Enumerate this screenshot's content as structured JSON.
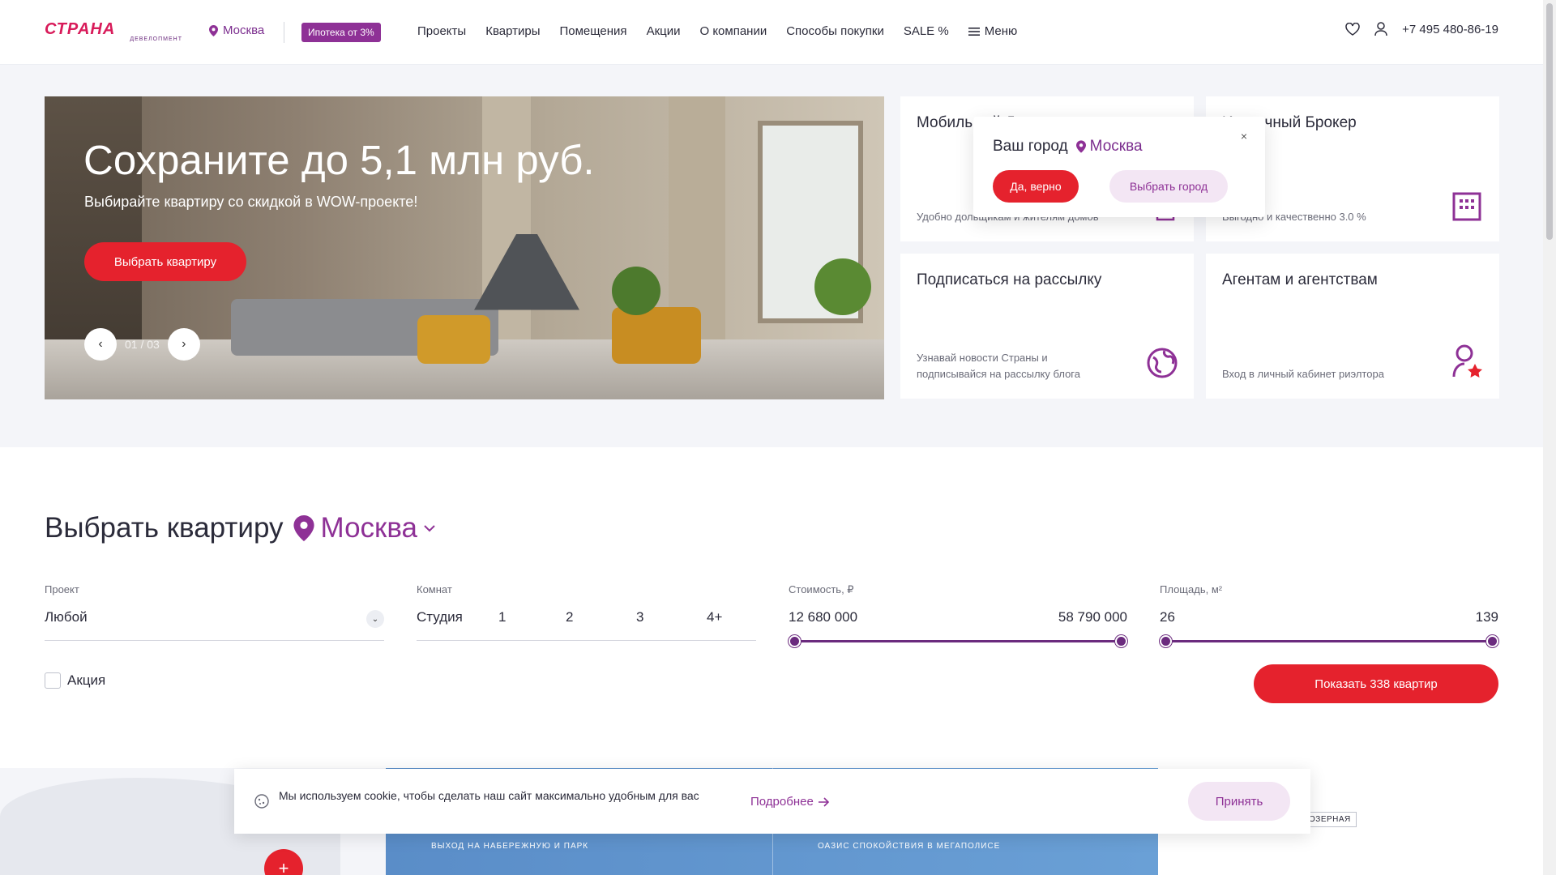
{
  "header": {
    "logo_text": "СТРАНА",
    "logo_sub": "ДЕВЕЛОПМЕНТ",
    "city": "Москва",
    "badge": "Ипотека от 3%",
    "nav": [
      "Проекты",
      "Квартиры",
      "Помещения",
      "Акции",
      "О компании",
      "Способы покупки",
      "SALE %"
    ],
    "menu_label": "Меню",
    "phone": "+7 495 480-86-19"
  },
  "hero": {
    "title": "Сохраните до 5,1 млн руб.",
    "subtitle": "Выбирайте квартиру со скидкой в WOW-проекте!",
    "button": "Выбрать квартиру",
    "counter": "01 / 03"
  },
  "cards": [
    {
      "title": "Мобильный Девелопер",
      "text": "Удобно дольщикам и жителям домов"
    },
    {
      "title": "Ипотечный Брокер",
      "text": "Выгодно и качественно 3.0 %"
    },
    {
      "title": "Подписаться на рассылку",
      "text": "Узнавай новости Страны и подписывайся на рассылку блога"
    },
    {
      "title": "Агентам и агентствам",
      "text": "Вход в личный кабинет риэлтора"
    }
  ],
  "city_popup": {
    "question": "Ваш город",
    "city": "Москва",
    "yes": "Да, верно",
    "choose": "Выбрать город",
    "close": "×"
  },
  "filter": {
    "title": "Выбрать квартиру",
    "city": "Москва",
    "project_label": "Проект",
    "project_value": "Любой",
    "rooms_label": "Комнат",
    "rooms": [
      "Студия",
      "1",
      "2",
      "3",
      "4+"
    ],
    "price_label": "Стоимость, ₽",
    "price_min": "12 680 000",
    "price_max": "58 790 000",
    "area_label": "Площадь, м²",
    "area_min": "26",
    "area_max": "139",
    "promo_label": "Акция",
    "show_button": "Показать 338 квартир"
  },
  "bottom": {
    "caption_left": "ВЫХОД НА НАБЕРЕЖНУЮ И ПАРК",
    "caption_right": "ОАЗИС СПОКОЙСТВИЯ В МЕГАПОЛИСЕ",
    "tag": "ОЗЕРНАЯ",
    "plus": "+"
  },
  "cookie": {
    "text": "Мы используем cookie, чтобы сделать наш сайт максимально удобным для вас",
    "more": "Подробнее",
    "accept": "Принять"
  },
  "colors": {
    "brand_red": "#e5222d",
    "brand_purple": "#8e3196",
    "logo_pink": "#d81b5a"
  }
}
